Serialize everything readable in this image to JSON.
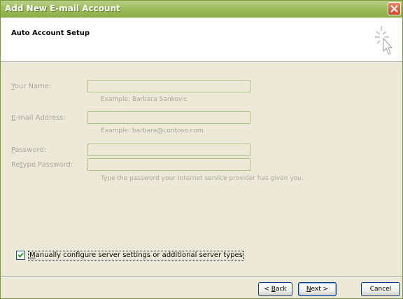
{
  "window": {
    "title": "Add New E-mail Account"
  },
  "header": {
    "heading": "Auto Account Setup"
  },
  "form": {
    "your_name": {
      "label_u": "Y",
      "label_rest": "our Name:",
      "value": "",
      "hint": "Example: Barbara Sankovic"
    },
    "email": {
      "label_u": "E",
      "label_rest": "-mail Address:",
      "value": "",
      "hint": "Example: barbara@contoso.com"
    },
    "password": {
      "label_u": "P",
      "label_rest": "assword:",
      "value": ""
    },
    "retype_password": {
      "label_pre": "Re",
      "label_u": "t",
      "label_rest": "ype Password:",
      "value": ""
    },
    "password_hint": "Type the password your Internet service provider has given you."
  },
  "manual_config": {
    "checked": true,
    "label_u": "M",
    "label_rest": "anually configure server settings or additional server types"
  },
  "buttons": {
    "back_pre": "< ",
    "back_u": "B",
    "back_rest": "ack",
    "next_u": "N",
    "next_rest": "ext >",
    "cancel": "Cancel"
  },
  "colors": {
    "titlebar": "#9fbf5e",
    "dialog_bg": "#ece9d8",
    "disabled_text": "#aca899"
  }
}
